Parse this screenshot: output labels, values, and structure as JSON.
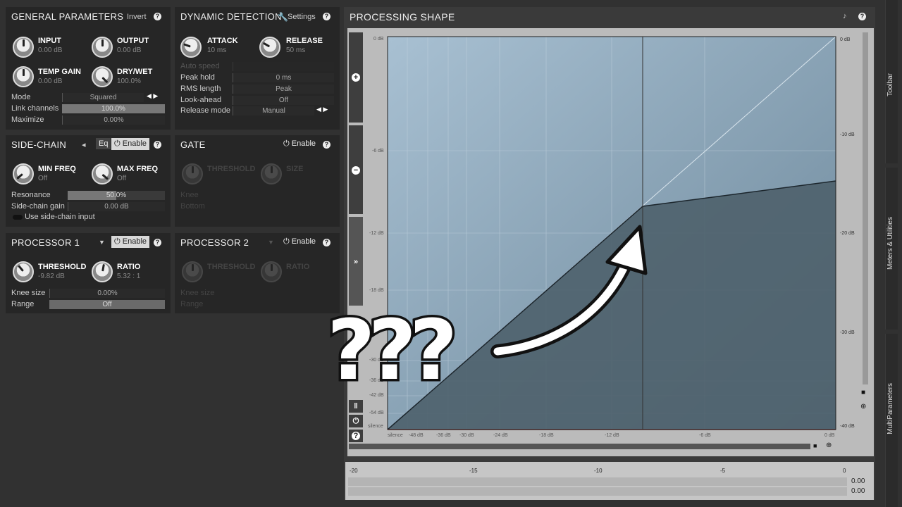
{
  "general": {
    "title": "GENERAL PARAMETERS",
    "invert": "Invert",
    "input": {
      "label": "INPUT",
      "value": "0.00 dB"
    },
    "output": {
      "label": "OUTPUT",
      "value": "0.00 dB"
    },
    "temp_gain": {
      "label": "TEMP GAIN",
      "value": "0.00 dB"
    },
    "dry_wet": {
      "label": "DRY/WET",
      "value": "100.0%"
    },
    "mode": {
      "label": "Mode",
      "value": "Squared"
    },
    "link": {
      "label": "Link channels",
      "value": "100.0%",
      "fill": 1.0
    },
    "maximize": {
      "label": "Maximize",
      "value": "0.00%"
    }
  },
  "dynamic": {
    "title": "DYNAMIC DETECTION",
    "settings": "Settings",
    "attack": {
      "label": "ATTACK",
      "value": "10 ms"
    },
    "release": {
      "label": "RELEASE",
      "value": "50 ms"
    },
    "auto_speed": {
      "label": "Auto speed"
    },
    "peak_hold": {
      "label": "Peak hold",
      "value": "0 ms"
    },
    "rms": {
      "label": "RMS length",
      "value": "Peak"
    },
    "lookahead": {
      "label": "Look-ahead",
      "value": "Off"
    },
    "release_mode": {
      "label": "Release mode",
      "value": "Manual"
    }
  },
  "sidechain": {
    "title": "SIDE-CHAIN",
    "eq": "Eq",
    "enable": "Enable",
    "min_freq": {
      "label": "MIN FREQ",
      "value": "Off"
    },
    "max_freq": {
      "label": "MAX FREQ",
      "value": "Off"
    },
    "resonance": {
      "label": "Resonance",
      "value": "50.0%",
      "fill": 0.5
    },
    "gain": {
      "label": "Side-chain gain",
      "value": "0.00 dB"
    },
    "use_input": "Use side-chain input"
  },
  "gate": {
    "title": "GATE",
    "enable": "Enable",
    "threshold": "THRESHOLD",
    "size": "SIZE",
    "knee": "Knee",
    "bottom": "Bottom"
  },
  "proc1": {
    "title": "PROCESSOR 1",
    "enable": "Enable",
    "threshold": {
      "label": "THRESHOLD",
      "value": "-9.82 dB"
    },
    "ratio": {
      "label": "RATIO",
      "value": "5.32 : 1"
    },
    "knee": {
      "label": "Knee size",
      "value": "0.00%"
    },
    "range": {
      "label": "Range",
      "value": "Off",
      "fill": 1.0
    }
  },
  "proc2": {
    "title": "PROCESSOR 2",
    "enable": "Enable",
    "threshold": "THRESHOLD",
    "ratio": "RATIO",
    "knee": "Knee size",
    "range": "Range"
  },
  "shape": {
    "title": "PROCESSING SHAPE",
    "y_labels": [
      "0 dB",
      "-6 dB",
      "-12 dB",
      "-18 dB",
      "-30 dB",
      "-36 dB",
      "-42 dB",
      "-54 dB",
      "silence"
    ],
    "x_labels": [
      "silence",
      "-48 dB",
      "-36 dB",
      "-30 dB",
      "-24 dB",
      "-18 dB",
      "-12 dB",
      "-6 dB",
      "0 dB"
    ],
    "right_labels": [
      "0 dB",
      "-10 dB",
      "-20 dB",
      "-30 dB",
      "-40 dB"
    ]
  },
  "meter": {
    "scale": [
      "-20",
      "-15",
      "-10",
      "-5",
      "0"
    ],
    "left": "0.00",
    "right": "0.00"
  },
  "tabs": {
    "toolbar": "Toolbar",
    "meters": "Meters & Utilities",
    "multi": "MultiParameters"
  },
  "overlay": {
    "marks": "???"
  }
}
